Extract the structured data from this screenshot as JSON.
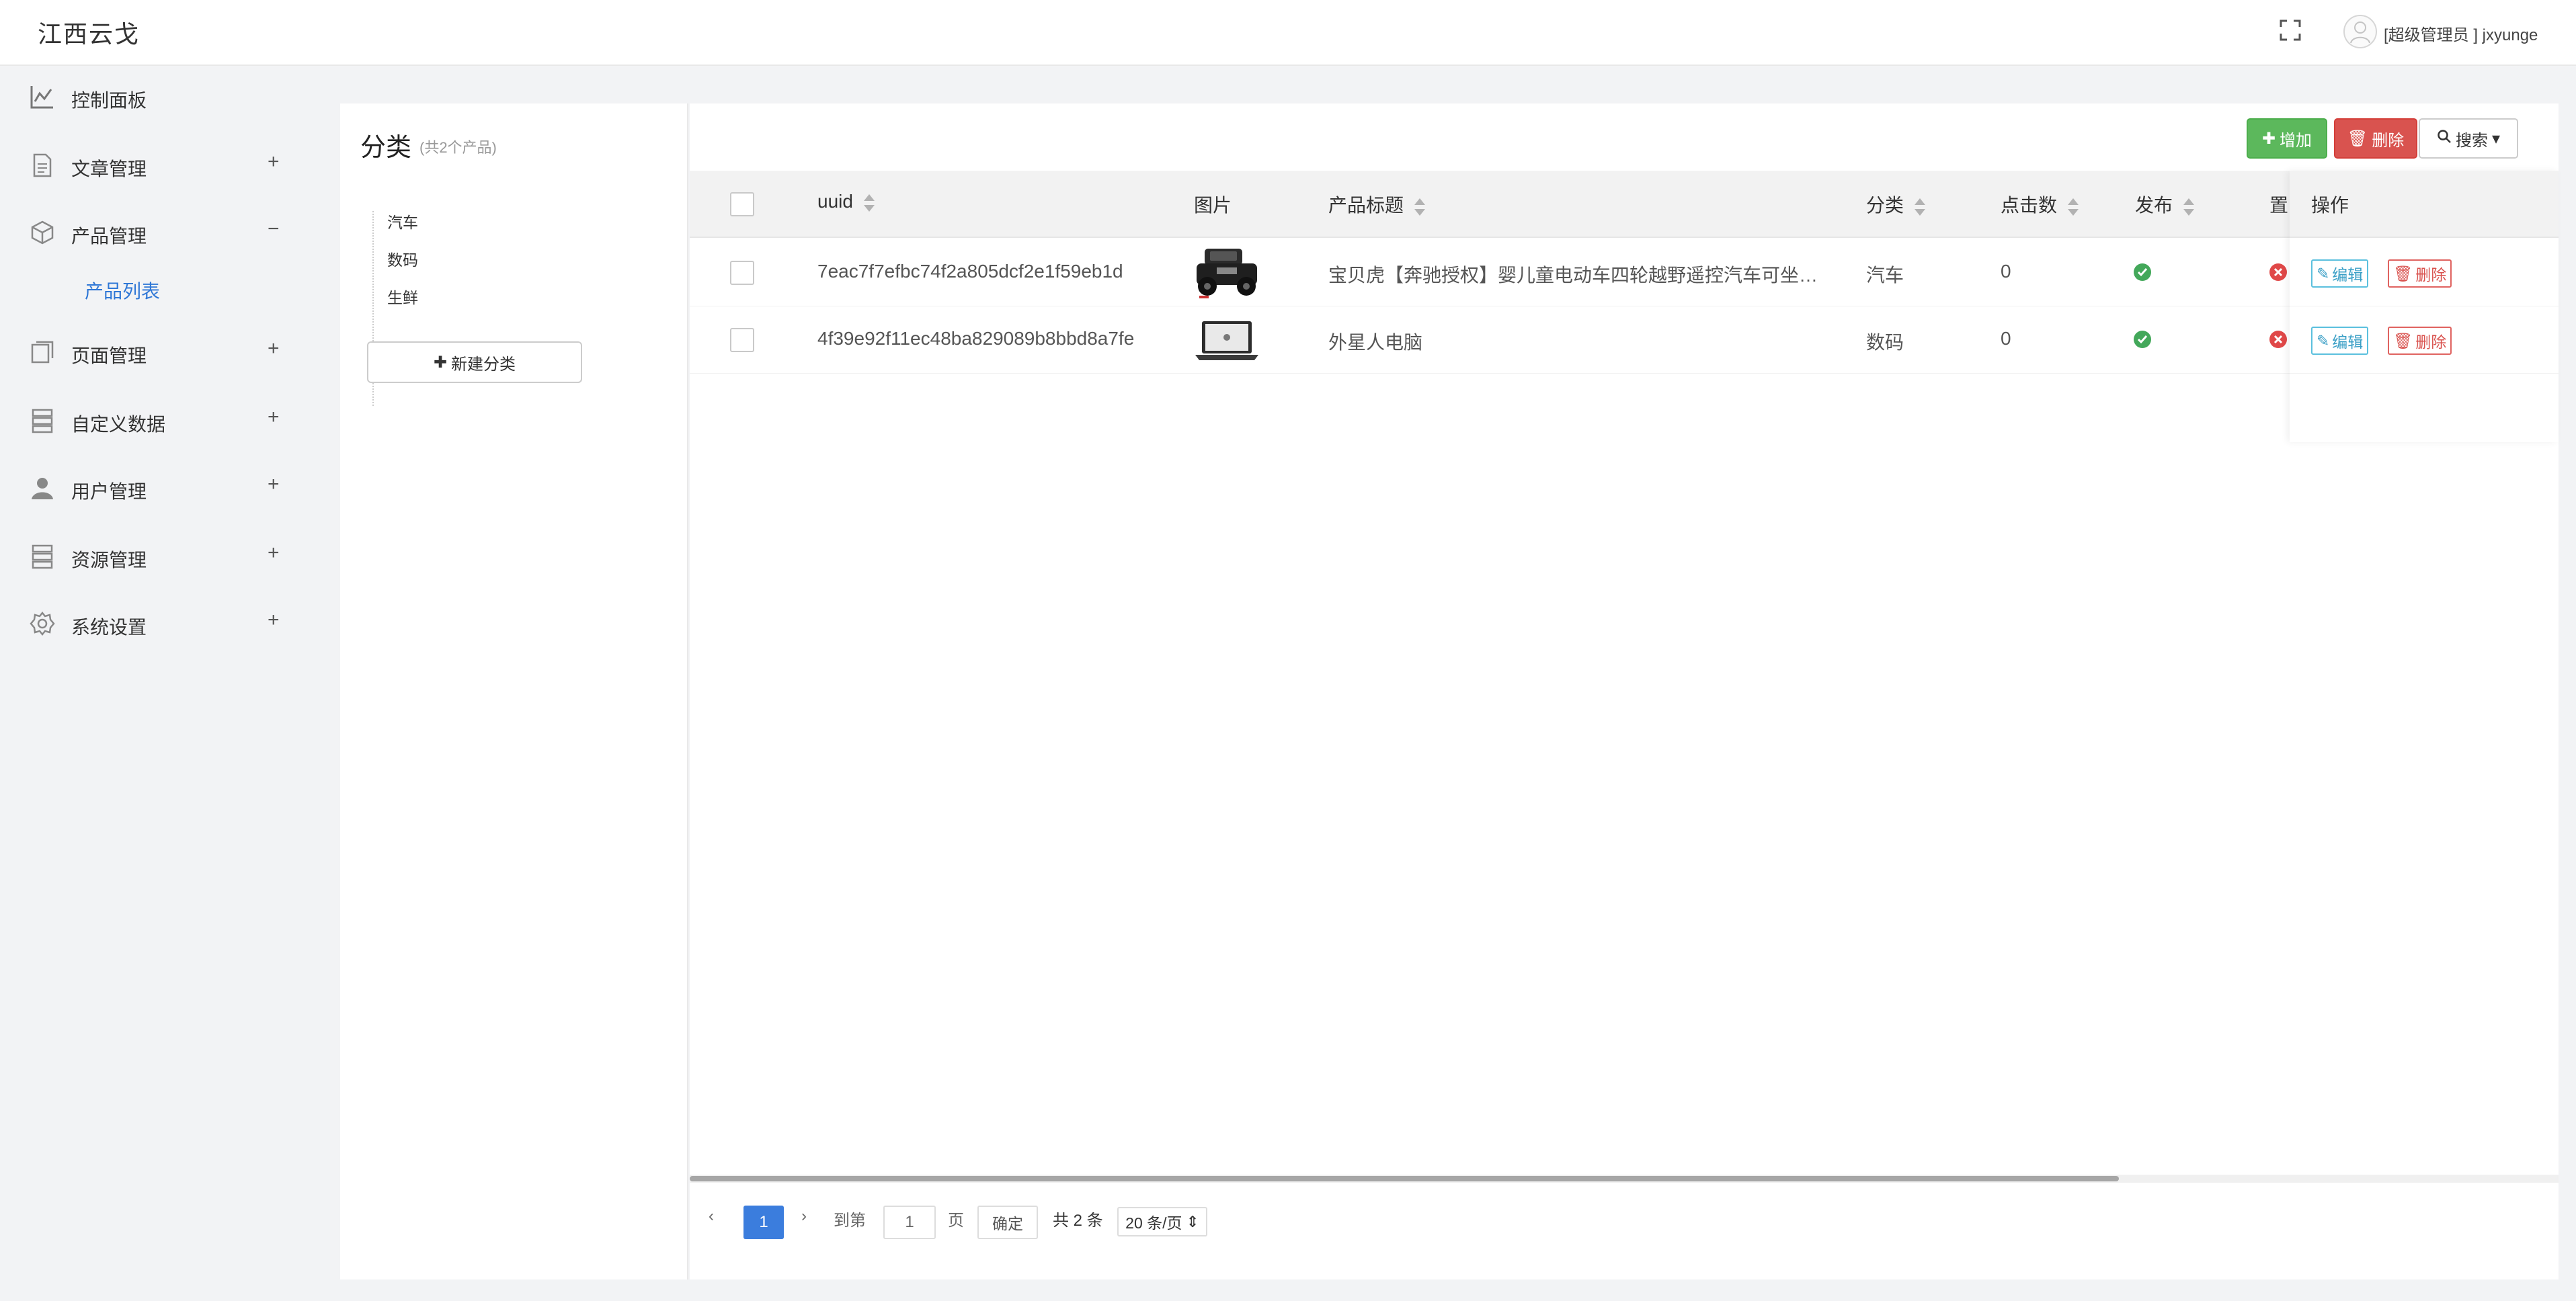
{
  "header": {
    "brand": "江西云戈",
    "user_label": "[超级管理员 ] jxyunge",
    "fullscreen_icon": "fullscreen-icon",
    "avatar_icon": "user-avatar-icon"
  },
  "sidebar": {
    "items": [
      {
        "label": "控制面板",
        "icon": "dashboard-icon",
        "toggle": ""
      },
      {
        "label": "文章管理",
        "icon": "document-icon",
        "toggle": "+"
      },
      {
        "label": "产品管理",
        "icon": "box-icon",
        "toggle": "−"
      },
      {
        "label": "页面管理",
        "icon": "page-icon",
        "toggle": "+"
      },
      {
        "label": "自定义数据",
        "icon": "database-icon",
        "toggle": "+"
      },
      {
        "label": "用户管理",
        "icon": "user-icon",
        "toggle": "+"
      },
      {
        "label": "资源管理",
        "icon": "storage-icon",
        "toggle": "+"
      },
      {
        "label": "系统设置",
        "icon": "gear-icon",
        "toggle": "+"
      }
    ],
    "sub_items": [
      {
        "label": "产品列表"
      }
    ],
    "active_color": "#2f77d6"
  },
  "category": {
    "title": "分类",
    "count": "(共2个产品)",
    "items": [
      "汽车",
      "数码",
      "生鲜"
    ],
    "new_button": "新建分类"
  },
  "toolbar": {
    "add": "增加",
    "delete": "删除",
    "search": "搜索",
    "add_color": "#5cb85c",
    "delete_color": "#d9534f"
  },
  "table": {
    "columns": [
      "uuid",
      "图片",
      "产品标题",
      "分类",
      "点击数",
      "发布",
      "置",
      "操作"
    ],
    "rows": [
      {
        "uuid": "7eac7f7efbc74f2a805dcf2e1f59eb1d",
        "image": "toy-car-image",
        "title": "宝贝虎【奔驰授权】婴儿童电动车四轮越野遥控汽车可坐…",
        "category": "汽车",
        "clicks": "0",
        "published": true,
        "top": false,
        "edit": "编辑",
        "delete": "删除"
      },
      {
        "uuid": "4f39e92f11ec48ba829089b8bbd8a7fe",
        "image": "laptop-image",
        "title": "外星人电脑",
        "category": "数码",
        "clicks": "0",
        "published": true,
        "top": false,
        "edit": "编辑",
        "delete": "删除"
      }
    ]
  },
  "pagination": {
    "current_page": "1",
    "goto_label": "到第",
    "goto_value": "1",
    "page_label": "页",
    "confirm": "确定",
    "total": "共 2 条",
    "page_size": "20 条/页"
  }
}
